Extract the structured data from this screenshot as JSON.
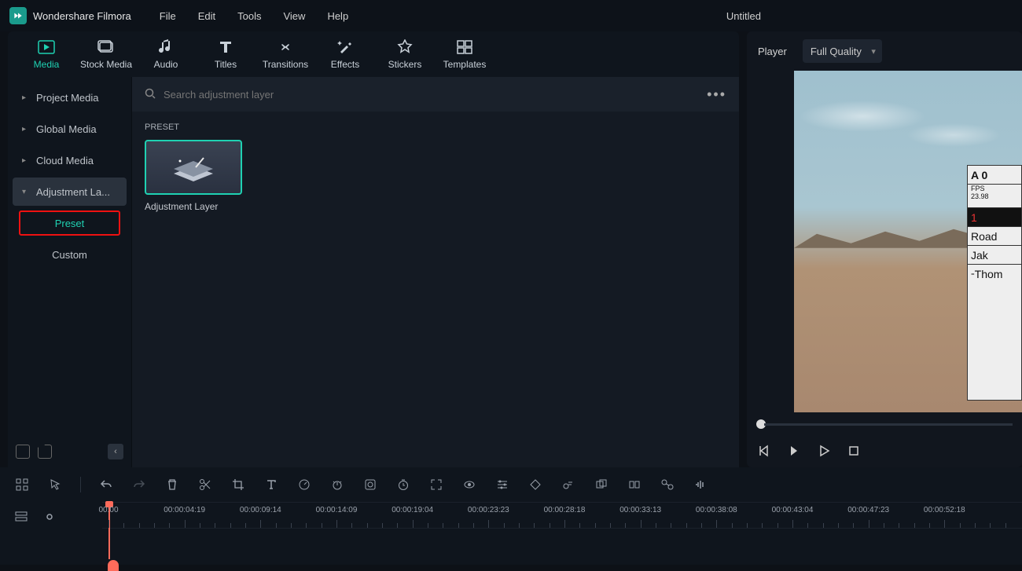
{
  "app": {
    "name": "Wondershare Filmora",
    "doc_title": "Untitled"
  },
  "menu": {
    "file": "File",
    "edit": "Edit",
    "tools": "Tools",
    "view": "View",
    "help": "Help"
  },
  "tabs": {
    "media": "Media",
    "stock": "Stock Media",
    "audio": "Audio",
    "titles": "Titles",
    "transitions": "Transitions",
    "effects": "Effects",
    "stickers": "Stickers",
    "templates": "Templates"
  },
  "sidebar": {
    "items": [
      {
        "label": "Project Media"
      },
      {
        "label": "Global Media"
      },
      {
        "label": "Cloud Media"
      },
      {
        "label": "Adjustment La..."
      }
    ],
    "subs": {
      "preset": "Preset",
      "custom": "Custom"
    }
  },
  "search": {
    "placeholder": "Search adjustment layer"
  },
  "content": {
    "section": "PRESET",
    "preset_label": "Adjustment Layer"
  },
  "preview": {
    "player_label": "Player",
    "quality": "Full Quality",
    "slate": {
      "r1": "A 0",
      "r2_label": "FPS",
      "r2_val": "23.98",
      "r3": "1",
      "r4": "Road",
      "r5": "Jak",
      "r6": "Thom"
    }
  },
  "timecodes": [
    "00:00",
    "00:00:04:19",
    "00:00:09:14",
    "00:00:14:09",
    "00:00:19:04",
    "00:00:23:23",
    "00:00:28:18",
    "00:00:33:13",
    "00:00:38:08",
    "00:00:43:04",
    "00:00:47:23",
    "00:00:52:18"
  ]
}
